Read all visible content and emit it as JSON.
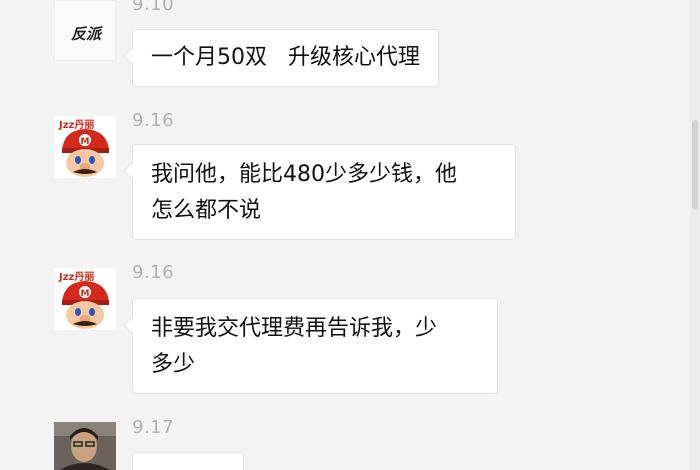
{
  "messages": [
    {
      "time": "9.10",
      "sender_avatar": "brand-logo-avatar",
      "avatar_text": "反派",
      "text": "一个月50双   升级核心代理"
    },
    {
      "time": "9.16",
      "sender_avatar": "mario-avatar",
      "avatar_badge": "Jzz丹丽",
      "text": "我问他，能比480少多少钱，他\n怎么都不说"
    },
    {
      "time": "9.16",
      "sender_avatar": "mario-avatar",
      "avatar_badge": "Jzz丹丽",
      "text": "非要我交代理费再告诉我，少\n多少"
    },
    {
      "time": "9.17",
      "sender_avatar": "person-photo-avatar",
      "text": ""
    }
  ],
  "colors": {
    "background": "#f3f3f3",
    "bubble": "#ffffff",
    "timestamp": "#b2b2b2",
    "mario_red": "#d42a1e"
  }
}
